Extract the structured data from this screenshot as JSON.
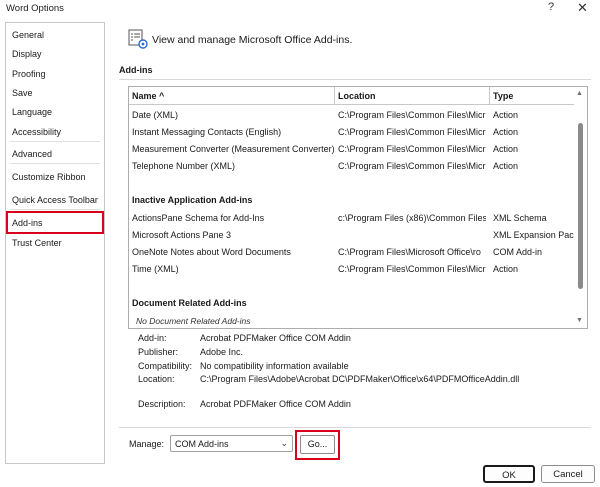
{
  "window": {
    "title": "Word Options",
    "help_glyph": "?",
    "close_glyph": "✕"
  },
  "sidebar": {
    "items": [
      {
        "label": "General"
      },
      {
        "label": "Display"
      },
      {
        "label": "Proofing"
      },
      {
        "label": "Save"
      },
      {
        "label": "Language"
      },
      {
        "label": "Accessibility"
      },
      {
        "label": "Advanced"
      },
      {
        "label": "Customize Ribbon"
      },
      {
        "label": "Quick Access Toolbar"
      },
      {
        "label": "Add-ins"
      },
      {
        "label": "Trust Center"
      }
    ],
    "selected": "Add-ins"
  },
  "header": {
    "text": "View and manage Microsoft Office Add-ins.",
    "icon": "add-ins-manage-icon"
  },
  "section": {
    "title": "Add-ins"
  },
  "table": {
    "columns": [
      "Name ^",
      "Location",
      "Type"
    ],
    "rows": [
      {
        "name": "Date (XML)",
        "location": "C:\\Program Files\\Common Files\\Micr",
        "type": "Action"
      },
      {
        "name": "Instant Messaging Contacts (English)",
        "location": "C:\\Program Files\\Common Files\\Micr",
        "type": "Action"
      },
      {
        "name": "Measurement Converter (Measurement Converter)",
        "location": "C:\\Program Files\\Common Files\\Micr",
        "type": "Action"
      },
      {
        "name": "Telephone Number (XML)",
        "location": "C:\\Program Files\\Common Files\\Micr",
        "type": "Action"
      }
    ],
    "inactive_group": "Inactive Application Add-ins",
    "inactive_rows": [
      {
        "name": "ActionsPane Schema for Add-Ins",
        "location": "c:\\Program Files (x86)\\Common Files",
        "type": "XML Schema"
      },
      {
        "name": "Microsoft Actions Pane 3",
        "location": "",
        "type": "XML Expansion Pack"
      },
      {
        "name": "OneNote Notes about Word Documents",
        "location": "C:\\Program Files\\Microsoft Office\\ro",
        "type": "COM Add-in"
      },
      {
        "name": "Time (XML)",
        "location": "C:\\Program Files\\Common Files\\Micr",
        "type": "Action"
      }
    ],
    "document_group": "Document Related Add-ins",
    "document_empty": "No Document Related Add-ins"
  },
  "details": {
    "addin_label": "Add-in:",
    "addin_value": "Acrobat PDFMaker Office COM Addin",
    "publisher_label": "Publisher:",
    "publisher_value": "Adobe Inc.",
    "compat_label": "Compatibility:",
    "compat_value": "No compatibility information available",
    "location_label": "Location:",
    "location_value": "C:\\Program Files\\Adobe\\Acrobat DC\\PDFMaker\\Office\\x64\\PDFMOfficeAddin.dll",
    "description_label": "Description:",
    "description_value": "Acrobat PDFMaker Office COM Addin"
  },
  "manage": {
    "label": "Manage:",
    "selected": "COM Add-ins",
    "go_label": "Go..."
  },
  "footer": {
    "ok_label": "OK",
    "cancel_label": "Cancel"
  },
  "colors": {
    "highlight": "#d9001b"
  }
}
